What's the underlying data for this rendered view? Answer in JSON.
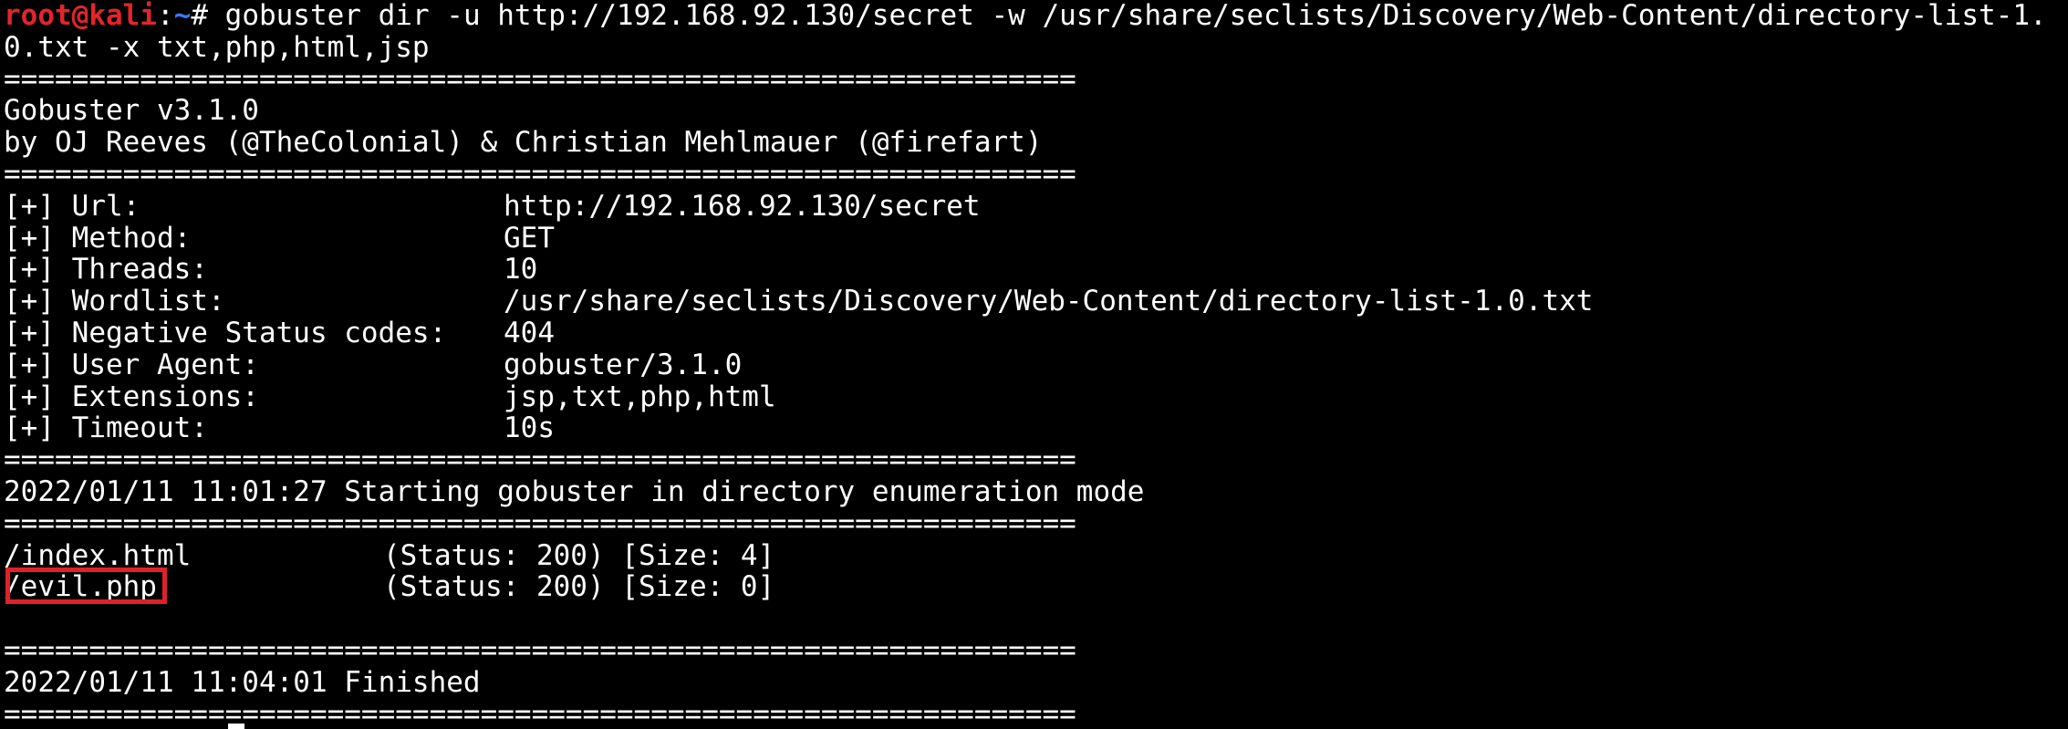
{
  "prompt": {
    "user_host": "root@kali",
    "colon": ":",
    "path": "~",
    "hash": "# "
  },
  "command_line1": "gobuster dir -u http://192.168.92.130/secret -w /usr/share/seclists/Discovery/Web-Content/directory-list-1.",
  "command_line2": "0.txt -x txt,php,html,jsp",
  "separator": "===============================================================",
  "banner": {
    "title": "Gobuster v3.1.0",
    "authors": "by OJ Reeves (@TheColonial) & Christian Mehlmauer (@firefart)"
  },
  "config": [
    {
      "key": "[+] Url:",
      "value": "http://192.168.92.130/secret"
    },
    {
      "key": "[+] Method:",
      "value": "GET"
    },
    {
      "key": "[+] Threads:",
      "value": "10"
    },
    {
      "key": "[+] Wordlist:",
      "value": "/usr/share/seclists/Discovery/Web-Content/directory-list-1.0.txt"
    },
    {
      "key": "[+] Negative Status codes:",
      "value": "404"
    },
    {
      "key": "[+] User Agent:",
      "value": "gobuster/3.1.0"
    },
    {
      "key": "[+] Extensions:",
      "value": "jsp,txt,php,html"
    },
    {
      "key": "[+] Timeout:",
      "value": "10s"
    }
  ],
  "start_message": "2022/01/11 11:01:27 Starting gobuster in directory enumeration mode",
  "results": [
    {
      "path": "/index.html",
      "status": "(Status: 200) [Size: 4]"
    },
    {
      "path": "/evil.php",
      "status": "(Status: 200) [Size: 0]"
    }
  ],
  "finish_message": "2022/01/11 11:04:01 Finished",
  "colors": {
    "background": "#000000",
    "text": "#ffffff",
    "prompt_user": "#e3242b",
    "prompt_path": "#3b78ff",
    "highlight_box": "#e0202a"
  }
}
